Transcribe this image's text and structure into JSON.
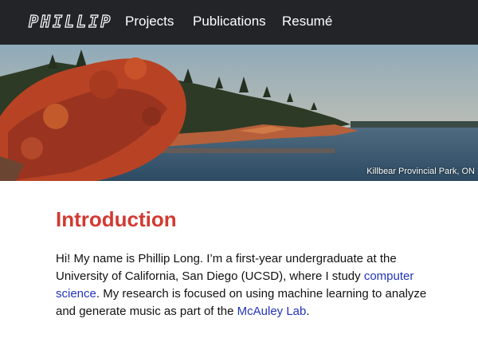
{
  "nav": {
    "logo": "PHILLIP",
    "links": [
      {
        "label": "Projects"
      },
      {
        "label": "Publications"
      },
      {
        "label": "Resumé"
      }
    ]
  },
  "hero": {
    "caption": "Killbear Provincial Park, ON",
    "colors": {
      "sky": "#a9b8be",
      "water": "#3b5a72",
      "forest": "#2d3a25",
      "leaves": "#b84324",
      "rock": "#b5603a"
    }
  },
  "intro": {
    "heading": "Introduction",
    "text_1": "Hi! My name is Phillip Long. I’m a first-year undergraduate at the University of California, San Diego (UCSD), where I study ",
    "link_1": "computer science",
    "text_2": ". My research is focused on using machine learning to analyze and generate music as part of the ",
    "link_2": "McAuley Lab",
    "text_3": "."
  },
  "colors": {
    "accent": "#d23a32",
    "link": "#2233bb",
    "nav_bg": "#222428"
  }
}
